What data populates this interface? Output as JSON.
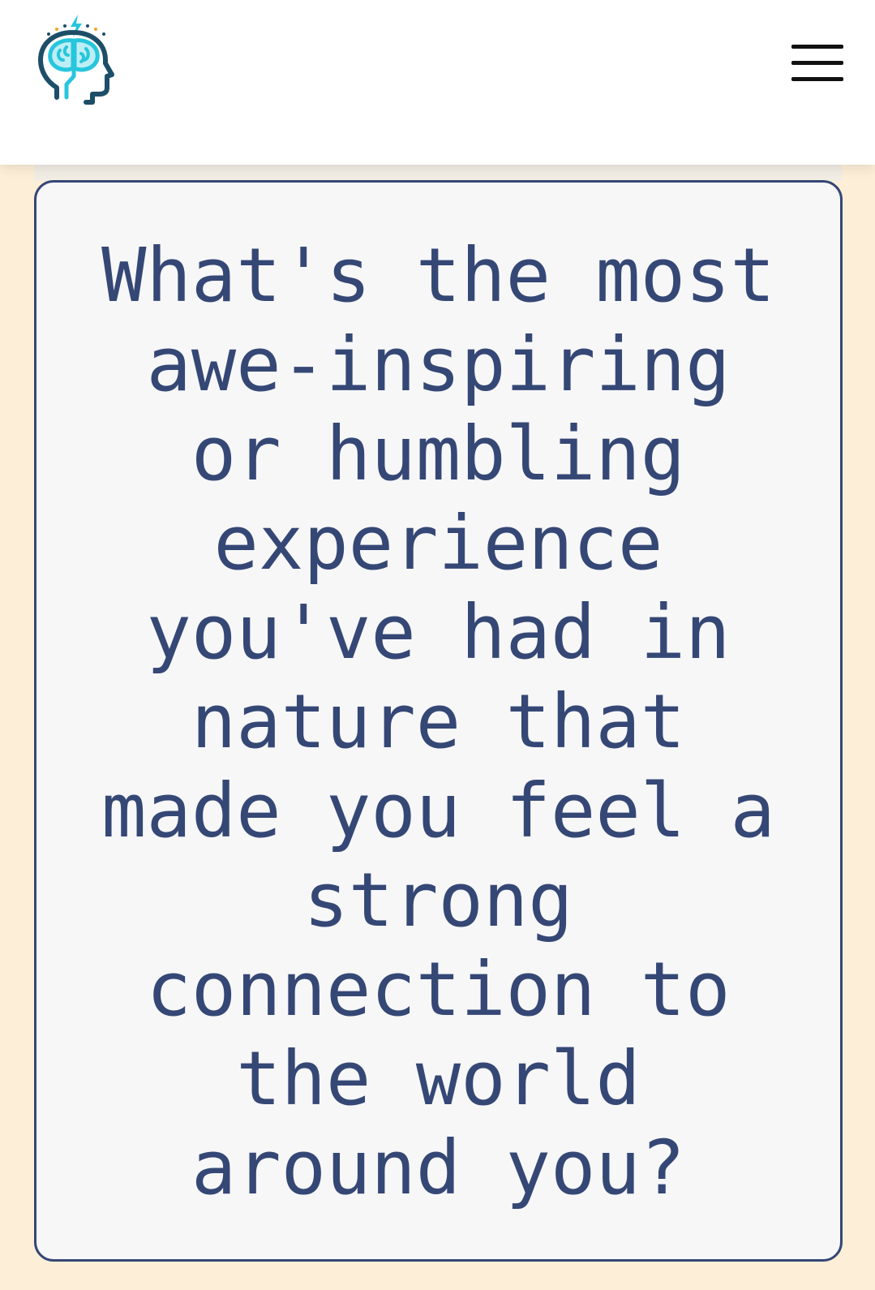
{
  "header": {
    "logo_icon": "brain-head-logo-icon",
    "menu_icon": "hamburger-menu-icon"
  },
  "card": {
    "question": "What's the most awe-inspiring or humbling experience you've had in nature that made you feel a strong connection to the world around you?"
  },
  "colors": {
    "background": "#fdefd7",
    "card_background": "#f7f7f8",
    "card_border": "#354775",
    "question_text": "#354775",
    "logo_cyan": "#27c6dd",
    "logo_navy": "#1d4e68",
    "logo_gold": "#f0a623"
  }
}
